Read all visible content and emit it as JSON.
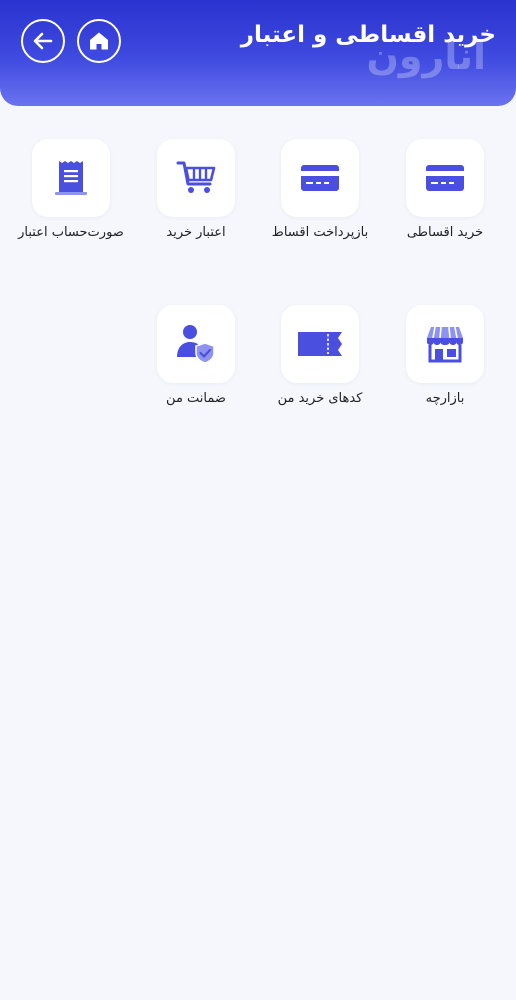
{
  "header": {
    "title": "خرید اقساطی و اعتبار",
    "watermark": "انارون",
    "back_icon": "arrow-left-icon",
    "home_icon": "home-icon"
  },
  "colors": {
    "accent": "#3d46dc",
    "icon": "#4a4fe0",
    "icon_light": "#8e93f2"
  },
  "menu": [
    {
      "label": "خرید اقساطی",
      "icon": "credit-card-icon"
    },
    {
      "label": "بازپرداخت اقساط",
      "icon": "credit-card-icon"
    },
    {
      "label": "اعتبار خرید",
      "icon": "shopping-cart-icon"
    },
    {
      "label": "صورت‌حساب اعتبار",
      "icon": "receipt-icon"
    },
    {
      "label": "بازارچه",
      "icon": "store-icon"
    },
    {
      "label": "کدهای خرید من",
      "icon": "ticket-icon"
    },
    {
      "label": "ضمانت من",
      "icon": "user-shield-icon"
    }
  ]
}
